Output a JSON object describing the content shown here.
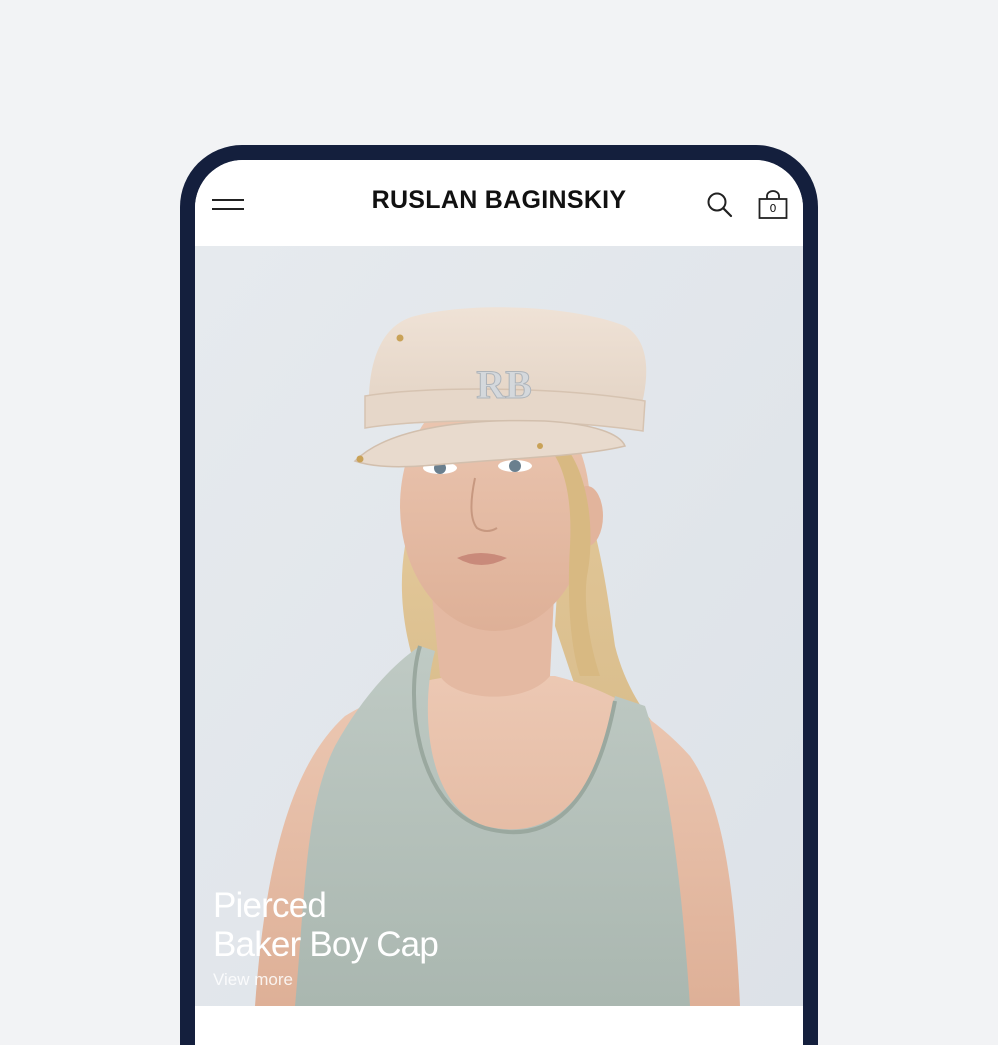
{
  "header": {
    "brand": "RUSLAN BAGINSKIY",
    "menu_icon": "hamburger-menu-icon",
    "search_icon": "search-icon",
    "bag_icon": "shopping-bag-icon",
    "bag_count": "0"
  },
  "hero": {
    "title_line1": "Pierced",
    "title_line2": "Baker Boy Cap",
    "link_label": "View more",
    "cap_monogram": "RB"
  },
  "colors": {
    "frame": "#141f3d",
    "background": "#f2f3f5",
    "text": "#111111",
    "overlay_text": "#ffffff"
  }
}
